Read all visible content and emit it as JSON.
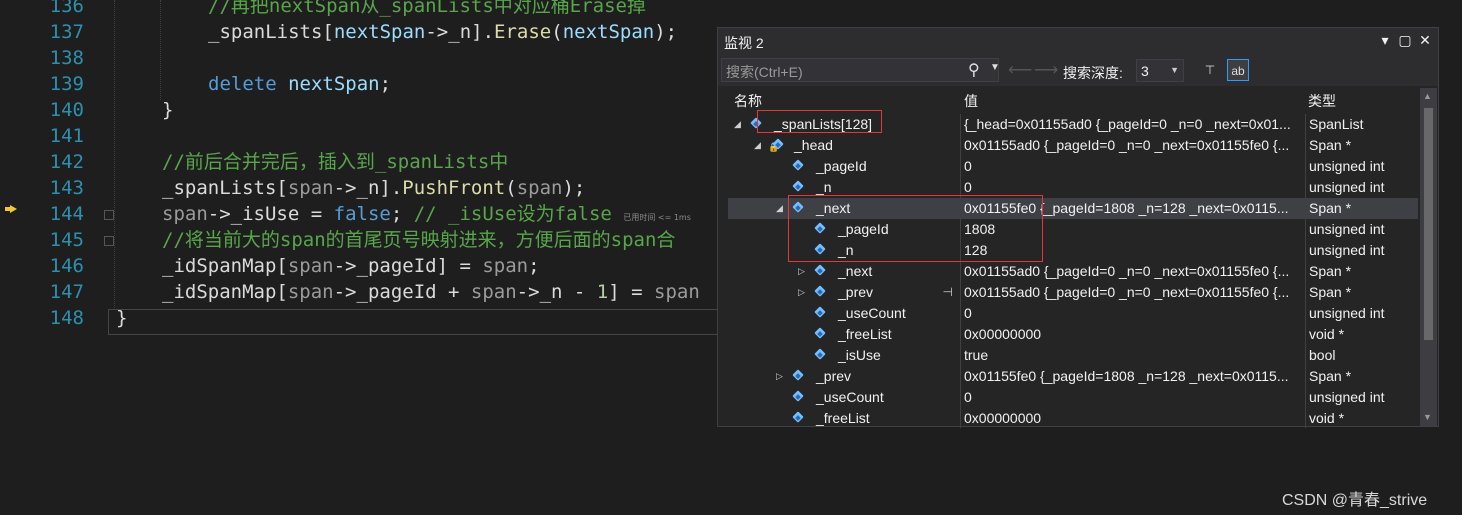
{
  "editor": {
    "line_numbers": [
      "136",
      "137",
      "138",
      "139",
      "140",
      "141",
      "142",
      "143",
      "144",
      "145",
      "146",
      "147",
      "148"
    ],
    "hint_text": "已用时间 <= 1ms",
    "lines": {
      "l136": "//再把nextSpan从_spanLists中对应桶Erase掉",
      "l137a": "_spanLists",
      "l137b": "[",
      "l137c": "nextSpan",
      "l137d": "->",
      "l137e": "_n",
      "l137f": "].",
      "l137g": "Erase",
      "l137h": "(",
      "l137i": "nextSpan",
      "l137j": ");",
      "l139a": "delete",
      "l139b": "nextSpan",
      "l139c": ";",
      "l140": "}",
      "l142": "//前后合并完后，插入到_spanLists中",
      "l143a": "_spanLists",
      "l143b": "[",
      "l143c": "span",
      "l143d": "->",
      "l143e": "_n",
      "l143f": "].",
      "l143g": "PushFront",
      "l143h": "(",
      "l143i": "span",
      "l143j": ");",
      "l144a": "span",
      "l144b": "->",
      "l144c": "_isUse",
      "l144d": " = ",
      "l144e": "false",
      "l144f": ";",
      "l144g": " // _isUse设为false",
      "l145": "//将当前大的span的首尾页号映射进来，方便后面的span合",
      "l146a": "_idSpanMap",
      "l146b": "[",
      "l146c": "span",
      "l146d": "->",
      "l146e": "_pageId",
      "l146f": "] = ",
      "l146g": "span",
      "l146h": ";",
      "l147a": "_idSpanMap",
      "l147b": "[",
      "l147c": "span",
      "l147d": "->",
      "l147e": "_pageId",
      "l147f": " + ",
      "l147g": "span",
      "l147h": "->",
      "l147i": "_n",
      "l147j": " - ",
      "l147k": "1",
      "l147l": "] = ",
      "l147m": "span",
      "l148": "}"
    }
  },
  "watch": {
    "title": "监视 2",
    "search_placeholder": "搜索(Ctrl+E)",
    "depth_label": "搜索深度:",
    "depth_value": "3",
    "columns": {
      "name": "名称",
      "value": "值",
      "type": "类型"
    },
    "rows": [
      {
        "name": "_spanLists[128]",
        "value": "{_head=0x01155ad0 {_pageId=0 _n=0 _next=0x01...",
        "type": "SpanList",
        "expanded": true
      },
      {
        "name": "_head",
        "value": "0x01155ad0 {_pageId=0 _n=0 _next=0x01155fe0 {...",
        "type": "Span *",
        "expanded": true
      },
      {
        "name": "_pageId",
        "value": "0",
        "type": "unsigned int"
      },
      {
        "name": "_n",
        "value": "0",
        "type": "unsigned int"
      },
      {
        "name": "_next",
        "value": "0x01155fe0 {_pageId=1808 _n=128 _next=0x0115...",
        "type": "Span *",
        "expanded": true
      },
      {
        "name": "_pageId",
        "value": "1808",
        "type": "unsigned int"
      },
      {
        "name": "_n",
        "value": "128",
        "type": "unsigned int"
      },
      {
        "name": "_next",
        "value": "0x01155ad0 {_pageId=0 _n=0 _next=0x01155fe0 {...",
        "type": "Span *",
        "expanded": false
      },
      {
        "name": "_prev",
        "value": "0x01155ad0 {_pageId=0 _n=0 _next=0x01155fe0 {...",
        "type": "Span *",
        "expanded": false
      },
      {
        "name": "_useCount",
        "value": "0",
        "type": "unsigned int"
      },
      {
        "name": "_freeList",
        "value": "0x00000000",
        "type": "void *"
      },
      {
        "name": "_isUse",
        "value": "true",
        "type": "bool"
      },
      {
        "name": "_prev",
        "value": "0x01155fe0 {_pageId=1808 _n=128 _next=0x0115...",
        "type": "Span *",
        "expanded": false
      },
      {
        "name": "_useCount",
        "value": "0",
        "type": "unsigned int"
      },
      {
        "name": "_freeList",
        "value": "0x00000000",
        "type": "void *"
      }
    ]
  },
  "watermark": "CSDN @青春_strive",
  "colors": {
    "highlight_box": "#e8343c",
    "accent": "#3399ff"
  }
}
